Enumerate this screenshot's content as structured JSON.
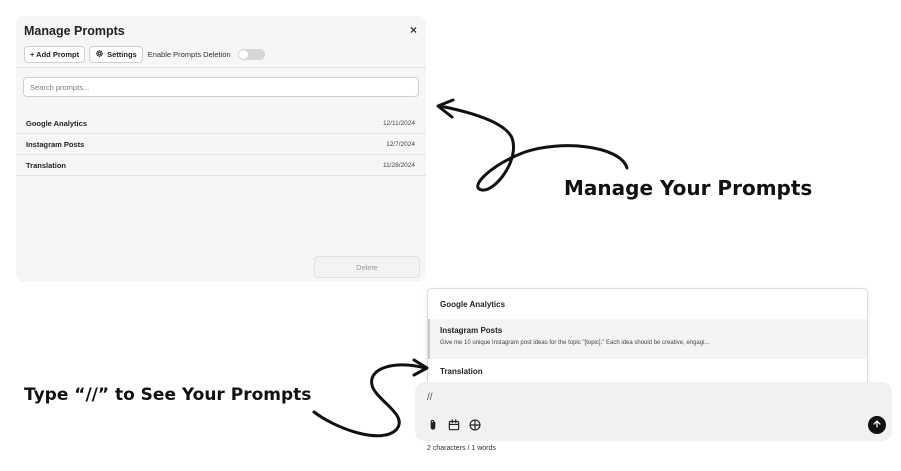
{
  "manage_panel": {
    "title": "Manage Prompts",
    "close_glyph": "×",
    "add_prompt_label": "+ Add Prompt",
    "settings_label": "Settings",
    "settings_icon": "gear-icon",
    "deletion_toggle_label": "Enable Prompts Deletion",
    "deletion_enabled": false,
    "search_placeholder": "Search prompts...",
    "prompts": [
      {
        "name": "Google Analytics",
        "date": "12/11/2024"
      },
      {
        "name": "Instagram Posts",
        "date": "12/7/2024"
      },
      {
        "name": "Translation",
        "date": "11/28/2024"
      }
    ],
    "delete_label": "Delete"
  },
  "dropdown": {
    "items": [
      {
        "name": "Google Analytics",
        "description": ""
      },
      {
        "name": "Instagram Posts",
        "description": "Give me 10 unique Instagram post ideas for the topic \"[topic].\" Each idea should be creative, engagi..."
      },
      {
        "name": "Translation",
        "description": ""
      }
    ],
    "active_index": 1
  },
  "chat_input": {
    "value": "//",
    "icons": [
      "paperclip-icon",
      "calendar-icon",
      "globe-icon"
    ],
    "send_icon": "arrow-up-icon",
    "counter": "2 characters / 1 words"
  },
  "annotations": {
    "manage": "Manage Your Prompts",
    "type": "Type “//” to See Your Prompts"
  },
  "colors": {
    "panel_bg": "#f6f6f7",
    "send_button": "#111111",
    "toggle_off": "#d6d6da"
  }
}
